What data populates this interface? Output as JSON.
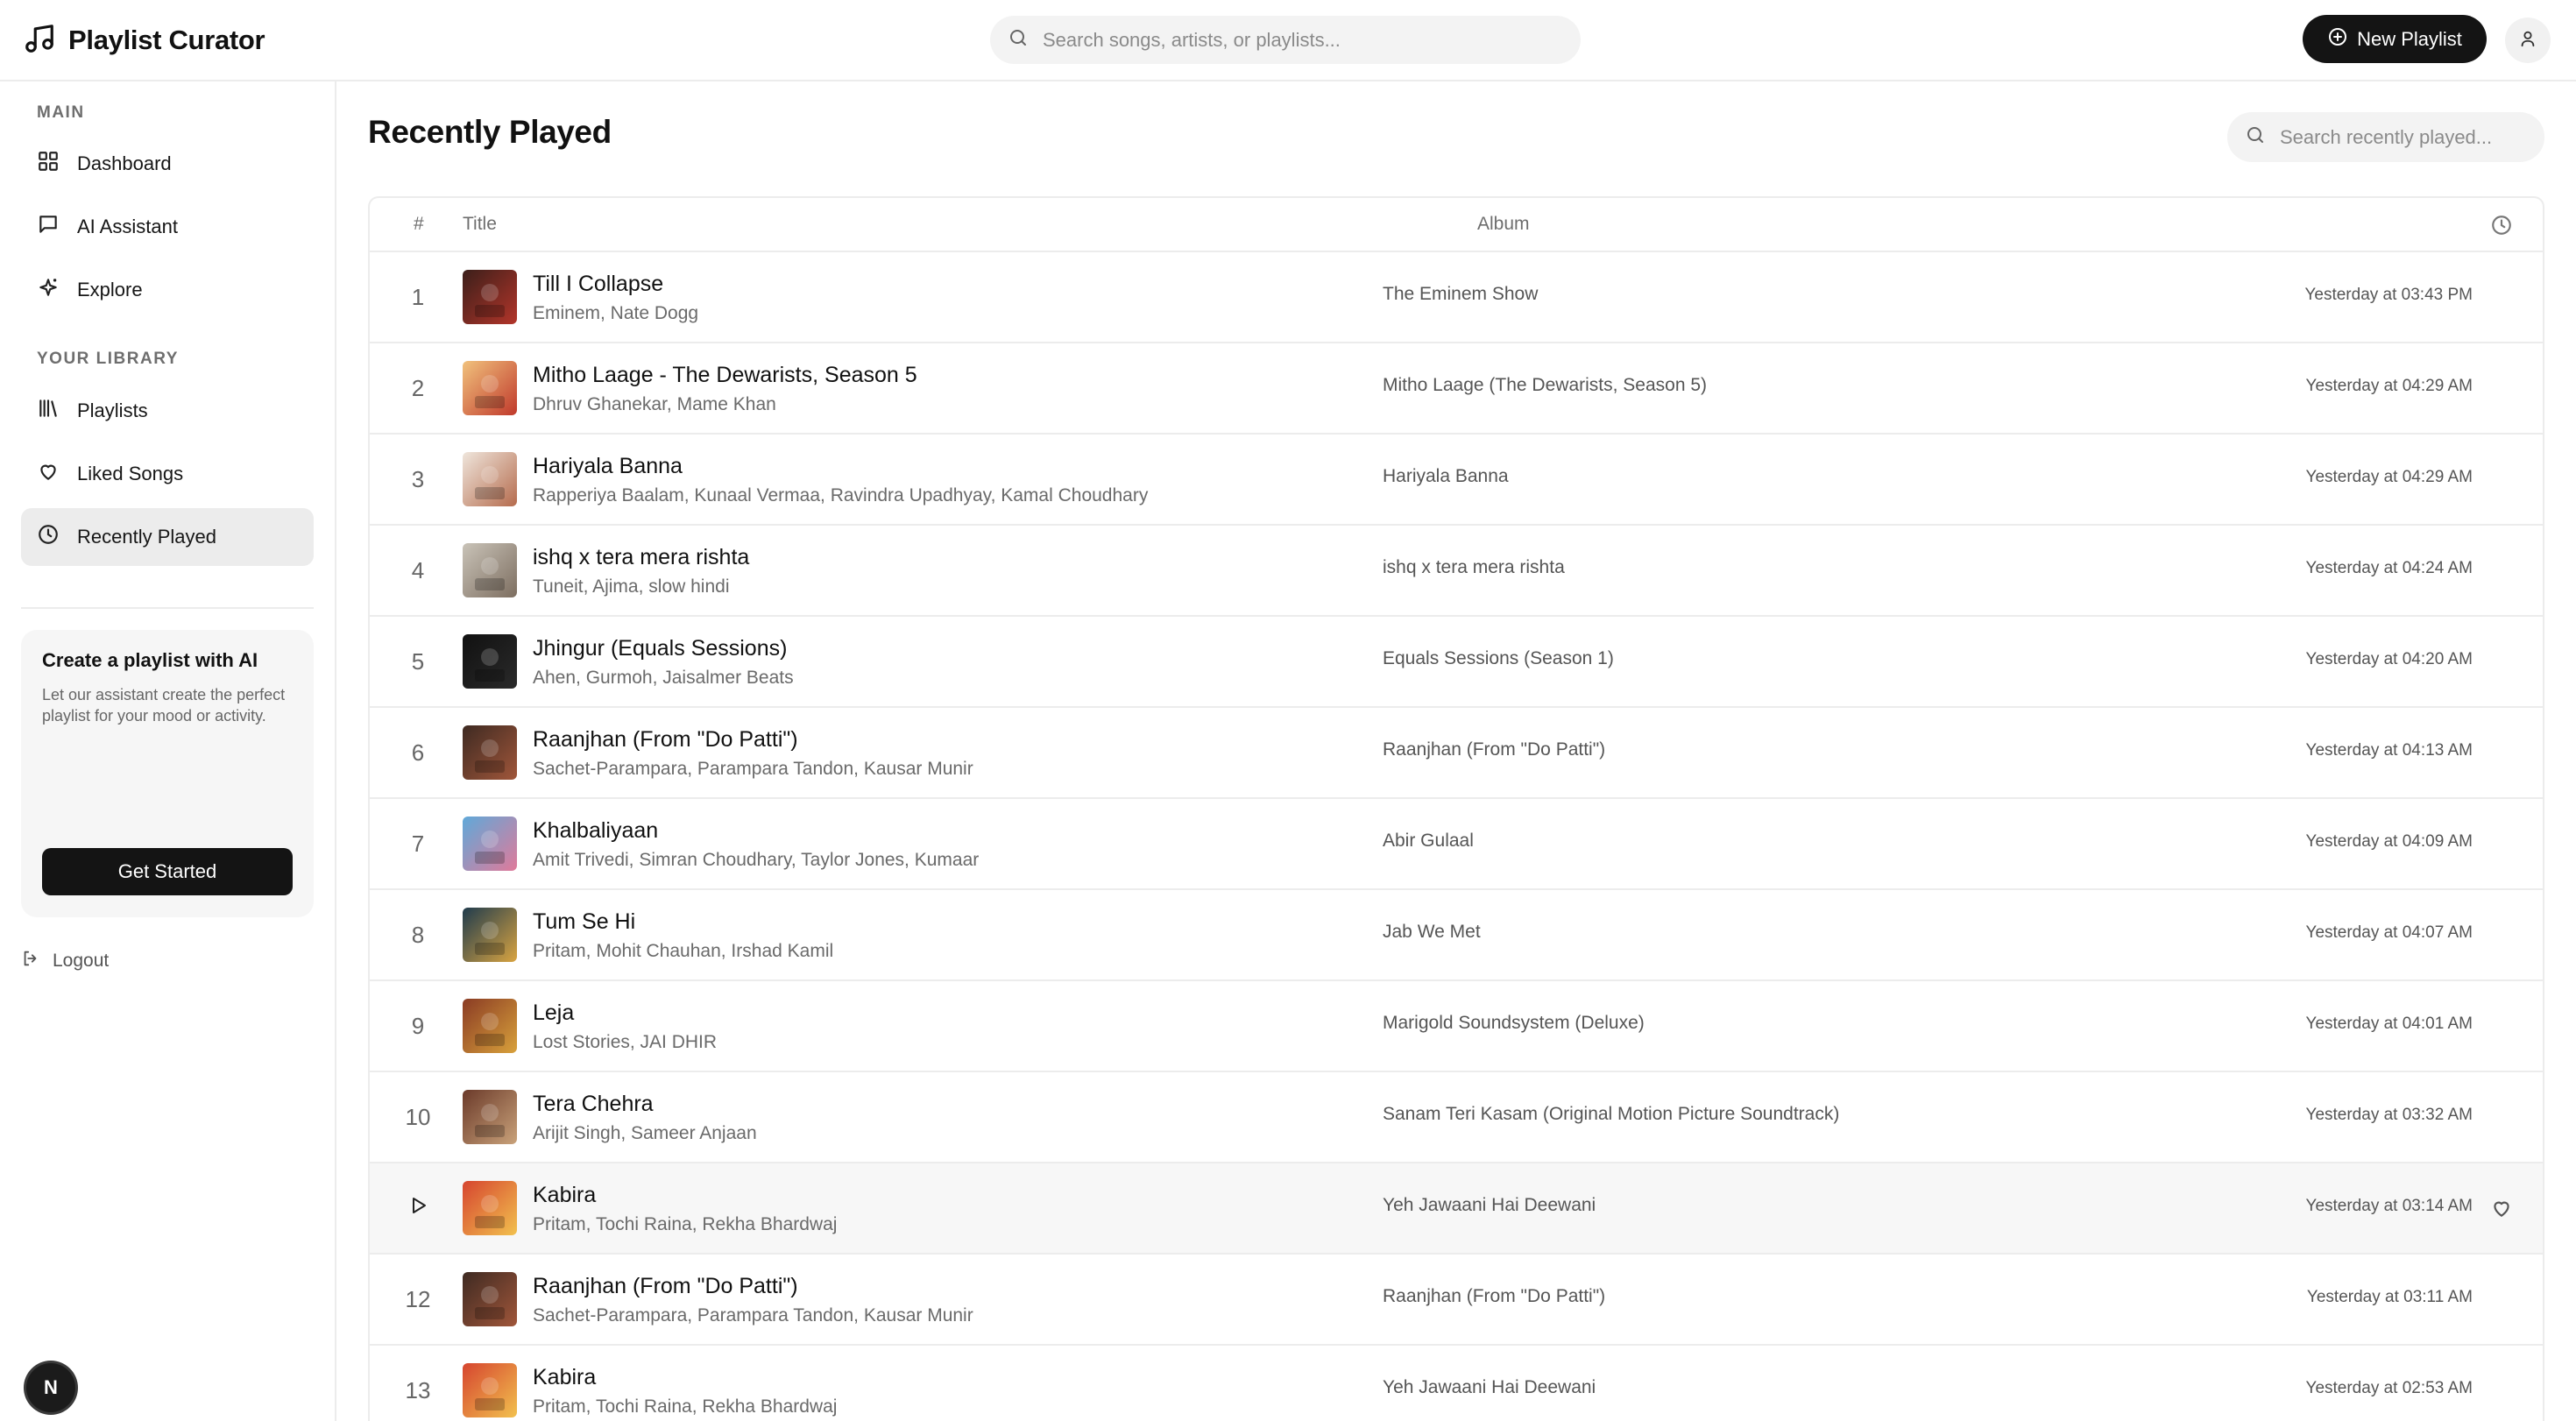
{
  "app": {
    "title": "Playlist Curator"
  },
  "header": {
    "search_placeholder": "Search songs, artists, or playlists...",
    "new_playlist_label": "New Playlist"
  },
  "sidebar": {
    "main_label": "MAIN",
    "library_label": "YOUR LIBRARY",
    "main_items": [
      {
        "label": "Dashboard",
        "icon": "dashboard-icon"
      },
      {
        "label": "AI Assistant",
        "icon": "chat-icon"
      },
      {
        "label": "Explore",
        "icon": "sparkles-icon"
      }
    ],
    "library_items": [
      {
        "label": "Playlists",
        "icon": "library-icon"
      },
      {
        "label": "Liked Songs",
        "icon": "heart-icon"
      },
      {
        "label": "Recently Played",
        "icon": "clock-icon",
        "active": true
      }
    ],
    "ai_card": {
      "title": "Create a playlist with AI",
      "description": "Let our assistant create the perfect playlist for your mood or activity.",
      "button_label": "Get Started"
    },
    "logout_label": "Logout",
    "badge_letter": "N"
  },
  "main": {
    "title": "Recently Played",
    "search_placeholder": "Search recently played...",
    "columns": {
      "num": "#",
      "title": "Title",
      "album": "Album"
    },
    "rows": [
      {
        "num": "1",
        "title": "Till I Collapse",
        "artists": "Eminem, Nate Dogg",
        "album": "The Eminem Show",
        "played": "Yesterday at 03:43 PM",
        "cover": [
          "#3b1f1a",
          "#b3352a"
        ]
      },
      {
        "num": "2",
        "title": "Mitho Laage - The Dewarists, Season 5",
        "artists": "Dhruv Ghanekar, Mame Khan",
        "album": "Mitho Laage (The Dewarists, Season 5)",
        "played": "Yesterday at 04:29 AM",
        "cover": [
          "#f1c27d",
          "#c0392b"
        ]
      },
      {
        "num": "3",
        "title": "Hariyala Banna",
        "artists": "Rapperiya Baalam, Kunaal Vermaa, Ravindra Upadhyay, Kamal Choudhary",
        "album": "Hariyala Banna",
        "played": "Yesterday at 04:29 AM",
        "cover": [
          "#efe6dc",
          "#b56b4d"
        ]
      },
      {
        "num": "4",
        "title": "ishq x tera mera rishta",
        "artists": "Tuneit, Ajima, slow hindi",
        "album": "ishq x tera mera rishta",
        "played": "Yesterday at 04:24 AM",
        "cover": [
          "#c9c3b8",
          "#7d6e60"
        ]
      },
      {
        "num": "5",
        "title": "Jhingur (Equals Sessions)",
        "artists": "Ahen, Gurmoh, Jaisalmer Beats",
        "album": "Equals Sessions (Season 1)",
        "played": "Yesterday at 04:20 AM",
        "cover": [
          "#111111",
          "#2a2a2a"
        ]
      },
      {
        "num": "6",
        "title": "Raanjhan (From \"Do Patti\")",
        "artists": "Sachet-Parampara, Parampara Tandon, Kausar Munir",
        "album": "Raanjhan (From \"Do Patti\")",
        "played": "Yesterday at 04:13 AM",
        "cover": [
          "#3e2a22",
          "#a0563a"
        ]
      },
      {
        "num": "7",
        "title": "Khalbaliyaan",
        "artists": "Amit Trivedi, Simran Choudhary, Taylor Jones, Kumaar",
        "album": "Abir Gulaal",
        "played": "Yesterday at 04:09 AM",
        "cover": [
          "#5fa9d9",
          "#e07a9a"
        ]
      },
      {
        "num": "8",
        "title": "Tum Se Hi",
        "artists": "Pritam, Mohit Chauhan, Irshad Kamil",
        "album": "Jab We Met",
        "played": "Yesterday at 04:07 AM",
        "cover": [
          "#1f3b4d",
          "#d9a441"
        ]
      },
      {
        "num": "9",
        "title": "Leja",
        "artists": "Lost Stories, JAI DHIR",
        "album": "Marigold Soundsystem (Deluxe)",
        "played": "Yesterday at 04:01 AM",
        "cover": [
          "#8a3b24",
          "#d8a13b"
        ]
      },
      {
        "num": "10",
        "title": "Tera Chehra",
        "artists": "Arijit Singh, Sameer Anjaan",
        "album": "Sanam Teri Kasam (Original Motion Picture Soundtrack)",
        "played": "Yesterday at 03:32 AM",
        "cover": [
          "#6b3a2a",
          "#c9a27a"
        ]
      },
      {
        "num": "",
        "title": "Kabira",
        "artists": "Pritam, Tochi Raina, Rekha Bhardwaj",
        "album": "Yeh Jawaani Hai Deewani",
        "played": "Yesterday at 03:14 AM",
        "cover": [
          "#d6452f",
          "#f2c14e"
        ],
        "hover": true
      },
      {
        "num": "12",
        "title": "Raanjhan (From \"Do Patti\")",
        "artists": "Sachet-Parampara, Parampara Tandon, Kausar Munir",
        "album": "Raanjhan (From \"Do Patti\")",
        "played": "Yesterday at 03:11 AM",
        "cover": [
          "#3e2a22",
          "#a0563a"
        ]
      },
      {
        "num": "13",
        "title": "Kabira",
        "artists": "Pritam, Tochi Raina, Rekha Bhardwaj",
        "album": "Yeh Jawaani Hai Deewani",
        "played": "Yesterday at 02:53 AM",
        "cover": [
          "#d6452f",
          "#f2c14e"
        ]
      }
    ]
  }
}
